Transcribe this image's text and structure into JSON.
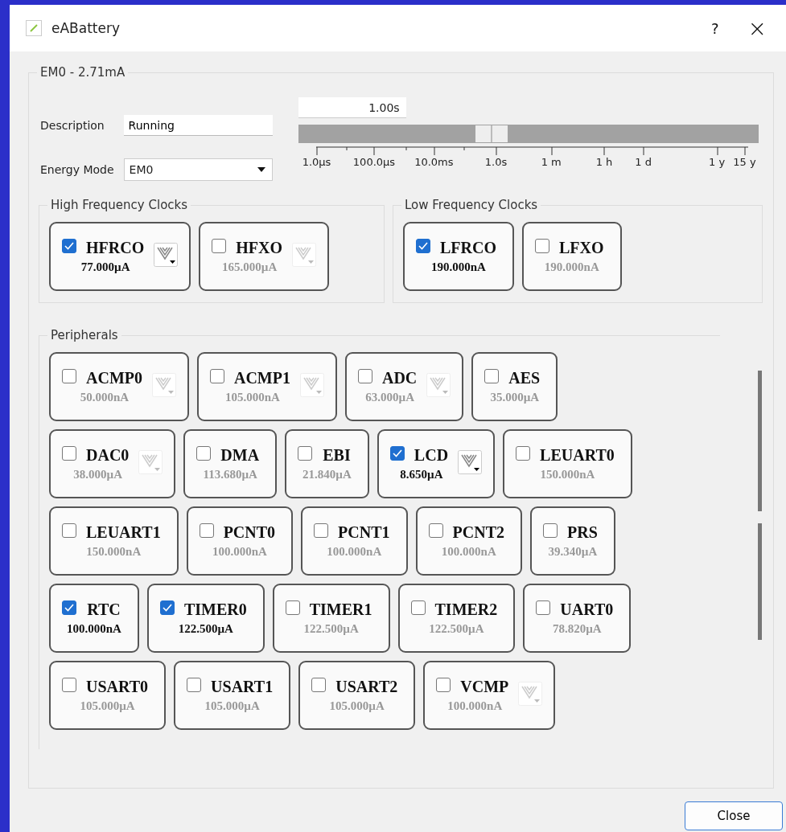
{
  "window": {
    "title": "eABattery",
    "help": "?",
    "close": "×"
  },
  "group": {
    "title": "EM0 - 2.71mA"
  },
  "description": {
    "label": "Description",
    "value": "Running"
  },
  "energy_mode": {
    "label": "Energy Mode",
    "value": "EM0"
  },
  "duration": {
    "value": "1.00s",
    "level": 0.42,
    "ticks": [
      "1.0µs",
      "100.0µs",
      "10.0ms",
      "1.0s",
      "1 m",
      "1 h",
      "1 d",
      "1 y",
      "15 y"
    ]
  },
  "high_frequency_clocks": {
    "title": "High Frequency Clocks",
    "items": [
      {
        "name": "HFRCO",
        "value": "77.000µA",
        "checked": true,
        "kind": "config"
      },
      {
        "name": "HFXO",
        "value": "165.000µA",
        "checked": false,
        "kind": "config"
      }
    ]
  },
  "low_frequency_clocks": {
    "title": "Low Frequency Clocks",
    "items": [
      {
        "name": "LFRCO",
        "value": "190.000nA",
        "checked": true,
        "kind": "plain"
      },
      {
        "name": "LFXO",
        "value": "190.000nA",
        "checked": false,
        "kind": "plain"
      }
    ]
  },
  "peripherals": {
    "title": "Peripherals",
    "rows": [
      [
        {
          "name": "ACMP0",
          "value": "50.000nA",
          "checked": false,
          "kind": "config"
        },
        {
          "name": "ACMP1",
          "value": "105.000nA",
          "checked": false,
          "kind": "config"
        },
        {
          "name": "ADC",
          "value": "63.000µA",
          "checked": false,
          "kind": "config"
        },
        {
          "name": "AES",
          "value": "35.000µA",
          "checked": false,
          "kind": "plain"
        }
      ],
      [
        {
          "name": "DAC0",
          "value": "38.000µA",
          "checked": false,
          "kind": "config"
        },
        {
          "name": "DMA",
          "value": "113.680µA",
          "checked": false,
          "kind": "plain"
        },
        {
          "name": "EBI",
          "value": "21.840µA",
          "checked": false,
          "kind": "plain"
        },
        {
          "name": "LCD",
          "value": "8.650µA",
          "checked": true,
          "kind": "config"
        },
        {
          "name": "LEUART0",
          "value": "150.000nA",
          "checked": false,
          "kind": "plain"
        }
      ],
      [
        {
          "name": "LEUART1",
          "value": "150.000nA",
          "checked": false,
          "kind": "plain"
        },
        {
          "name": "PCNT0",
          "value": "100.000nA",
          "checked": false,
          "kind": "plain"
        },
        {
          "name": "PCNT1",
          "value": "100.000nA",
          "checked": false,
          "kind": "plain"
        },
        {
          "name": "PCNT2",
          "value": "100.000nA",
          "checked": false,
          "kind": "plain"
        },
        {
          "name": "PRS",
          "value": "39.340µA",
          "checked": false,
          "kind": "plain"
        }
      ],
      [
        {
          "name": "RTC",
          "value": "100.000nA",
          "checked": true,
          "kind": "plain"
        },
        {
          "name": "TIMER0",
          "value": "122.500µA",
          "checked": true,
          "kind": "plain"
        },
        {
          "name": "TIMER1",
          "value": "122.500µA",
          "checked": false,
          "kind": "plain"
        },
        {
          "name": "TIMER2",
          "value": "122.500µA",
          "checked": false,
          "kind": "plain"
        },
        {
          "name": "UART0",
          "value": "78.820µA",
          "checked": false,
          "kind": "plain"
        }
      ],
      [
        {
          "name": "USART0",
          "value": "105.000µA",
          "checked": false,
          "kind": "plain"
        },
        {
          "name": "USART1",
          "value": "105.000µA",
          "checked": false,
          "kind": "plain"
        },
        {
          "name": "USART2",
          "value": "105.000µA",
          "checked": false,
          "kind": "plain"
        },
        {
          "name": "VCMP",
          "value": "100.000nA",
          "checked": false,
          "kind": "config"
        }
      ]
    ]
  },
  "buttons": [
    "Close"
  ]
}
